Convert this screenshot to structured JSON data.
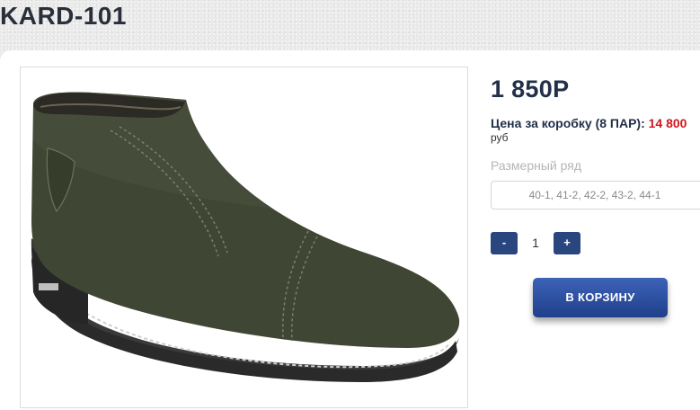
{
  "product": {
    "title": "KARD-101",
    "price": "1 850P",
    "box_price_label": "Цена за коробку (8 ПАР): ",
    "box_price_value": "14 800",
    "currency": "руб",
    "size_label": "Размерный ряд",
    "sizes": "40-1, 41-2, 42-2, 43-2, 44-1",
    "image_alt": "dark green nubuck ankle boot"
  },
  "quantity": {
    "minus_label": "-",
    "value": "1",
    "plus_label": "+"
  },
  "cart": {
    "button_label": "В КОРЗИНУ"
  },
  "colors": {
    "price_text": "#22304a",
    "box_price_value": "#d2141d",
    "button_bg": "#29467f"
  }
}
